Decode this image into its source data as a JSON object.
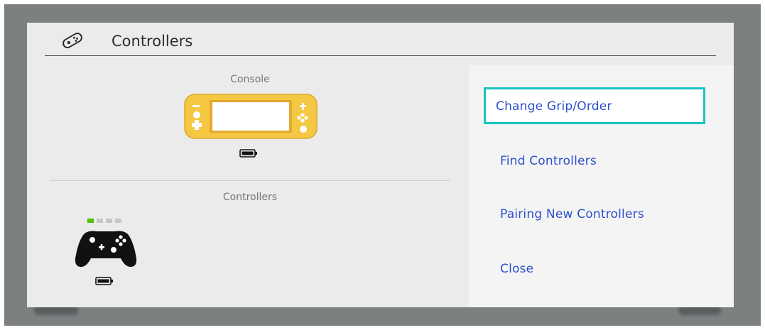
{
  "dialog": {
    "title": "Controllers",
    "title_icon": "joycon-icon"
  },
  "left": {
    "console_label": "Console",
    "console_icon": "switch-lite-icon",
    "console_color": "#f4c843",
    "console_battery_icon": "battery-full-icon",
    "controllers_label": "Controllers",
    "controller_icon": "pro-controller-icon",
    "player_leds": [
      true,
      false,
      false,
      false
    ],
    "controller_battery_icon": "battery-full-icon"
  },
  "menu": {
    "items": [
      {
        "label": "Change Grip/Order",
        "focused": true
      },
      {
        "label": "Find Controllers",
        "focused": false
      },
      {
        "label": "Pairing New Controllers",
        "focused": false
      },
      {
        "label": "Close",
        "focused": false
      }
    ]
  },
  "colors": {
    "focus_border": "#19c3c1",
    "menu_text": "#2d4fcc",
    "player_led_on": "#4fc100"
  }
}
